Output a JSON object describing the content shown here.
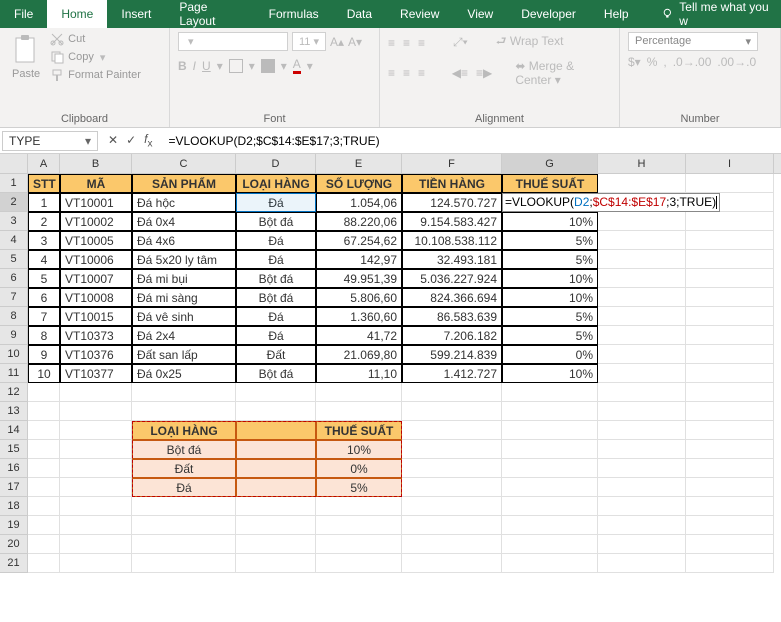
{
  "ribbon": {
    "tabs": [
      "File",
      "Home",
      "Insert",
      "Page Layout",
      "Formulas",
      "Data",
      "Review",
      "View",
      "Developer",
      "Help"
    ],
    "active_tab": "Home",
    "tell_me": "Tell me what you w",
    "clipboard": {
      "paste": "Paste",
      "cut": "Cut",
      "copy": "Copy",
      "format_painter": "Format Painter",
      "label": "Clipboard"
    },
    "font": {
      "size": "11",
      "label": "Font"
    },
    "alignment": {
      "wrap": "Wrap Text",
      "merge": "Merge & Center",
      "label": "Alignment"
    },
    "number": {
      "format": "Percentage",
      "label": "Number"
    }
  },
  "namebox": "TYPE",
  "formula_bar": "=VLOOKUP(D2;$C$14:$E$17;3;TRUE)",
  "columns": [
    "A",
    "B",
    "C",
    "D",
    "E",
    "F",
    "G",
    "H",
    "I"
  ],
  "col_widths": [
    "cA",
    "cB",
    "cC",
    "cD",
    "cE",
    "cF",
    "cG",
    "cH",
    "cI"
  ],
  "table": {
    "headers": [
      "STT",
      "MÃ",
      "SẢN PHẨM",
      "LOẠI HÀNG",
      "SỐ LƯỢNG",
      "TIỀN HÀNG",
      "THUẾ SUẤT"
    ],
    "rows": [
      {
        "stt": "1",
        "ma": "VT10001",
        "sp": "Đá hộc",
        "lh": "Đá",
        "sl": "1.054,06",
        "th": "124.570.727",
        "ts": ""
      },
      {
        "stt": "2",
        "ma": "VT10002",
        "sp": "Đá 0x4",
        "lh": "Bột đá",
        "sl": "88.220,06",
        "th": "9.154.583.427",
        "ts": "10%"
      },
      {
        "stt": "3",
        "ma": "VT10005",
        "sp": "Đá 4x6",
        "lh": "Đá",
        "sl": "67.254,62",
        "th": "10.108.538.112",
        "ts": "5%"
      },
      {
        "stt": "4",
        "ma": "VT10006",
        "sp": "Đá 5x20 ly tâm",
        "lh": "Đá",
        "sl": "142,97",
        "th": "32.493.181",
        "ts": "5%"
      },
      {
        "stt": "5",
        "ma": "VT10007",
        "sp": "Đá mi bụi",
        "lh": "Bột đá",
        "sl": "49.951,39",
        "th": "5.036.227.924",
        "ts": "10%"
      },
      {
        "stt": "6",
        "ma": "VT10008",
        "sp": "Đá mi sàng",
        "lh": "Bột đá",
        "sl": "5.806,60",
        "th": "824.366.694",
        "ts": "10%"
      },
      {
        "stt": "7",
        "ma": "VT10015",
        "sp": "Đá vê sinh",
        "lh": "Đá",
        "sl": "1.360,60",
        "th": "86.583.639",
        "ts": "5%"
      },
      {
        "stt": "8",
        "ma": "VT10373",
        "sp": "Đá 2x4",
        "lh": "Đá",
        "sl": "41,72",
        "th": "7.206.182",
        "ts": "5%"
      },
      {
        "stt": "9",
        "ma": "VT10376",
        "sp": "Đất san lấp",
        "lh": "Đất",
        "sl": "21.069,80",
        "th": "599.214.839",
        "ts": "0%"
      },
      {
        "stt": "10",
        "ma": "VT10377",
        "sp": "Đá 0x25",
        "lh": "Bột đá",
        "sl": "11,10",
        "th": "1.412.727",
        "ts": "10%"
      }
    ]
  },
  "lookup": {
    "header1": "LOẠI HÀNG",
    "header2": "THUẾ SUẤT",
    "rows": [
      {
        "lh": "Bột đá",
        "mid": "",
        "ts": "10%"
      },
      {
        "lh": "Đất",
        "mid": "",
        "ts": "0%"
      },
      {
        "lh": "Đá",
        "mid": "",
        "ts": "5%"
      }
    ]
  },
  "incell_formula": {
    "pre": "=VLOOKUP(",
    "arg1": "D2",
    "sep1": ";",
    "arg2": "$C$14:$E$17",
    "post": ";3;TRUE)"
  }
}
